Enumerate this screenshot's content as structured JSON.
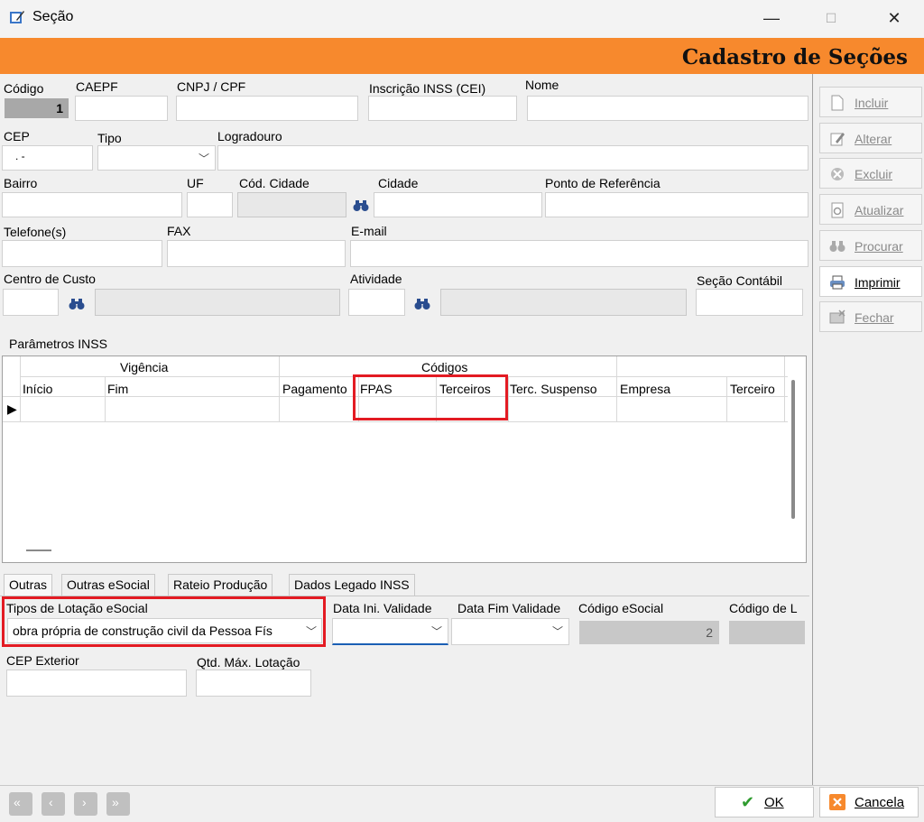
{
  "window": {
    "title": "Seção",
    "minimize": "—",
    "maximize": "☐",
    "close": "✕"
  },
  "header": {
    "title": "Cadastro de Seções"
  },
  "row1": {
    "codigo_label": "Código",
    "codigo_value": "1",
    "caepf_label": "CAEPF",
    "cnpj_label": "CNPJ / CPF",
    "inscricao_label": "Inscrição INSS (CEI)",
    "nome_label": "Nome"
  },
  "row2": {
    "cep_label": "CEP",
    "cep_value": ". -",
    "tipo_label": "Tipo",
    "logradouro_label": "Logradouro"
  },
  "row3": {
    "bairro_label": "Bairro",
    "uf_label": "UF",
    "cod_cidade_label": "Cód. Cidade",
    "cidade_label": "Cidade",
    "ponto_label": "Ponto de Referência"
  },
  "row4": {
    "telefone_label": "Telefone(s)",
    "fax_label": "FAX",
    "email_label": "E-mail"
  },
  "row5": {
    "centro_label": "Centro de Custo",
    "atividade_label": "Atividade",
    "secao_contabil_label": "Seção Contábil"
  },
  "inss": {
    "group_label": "Parâmetros INSS",
    "vigencia": "Vigência",
    "codigos": "Códigos",
    "columns": [
      "Início",
      "Fim",
      "Pagamento",
      "FPAS",
      "Terceiros",
      "Terc. Suspenso",
      "Empresa",
      "Terceiro"
    ]
  },
  "tabs": [
    "Outras",
    "Outras eSocial",
    "Rateio Produção",
    "Dados Legado INSS"
  ],
  "outras": {
    "tipos_label": "Tipos de Lotação eSocial",
    "tipos_value": "obra própria de construção civil da Pessoa Fís",
    "data_ini_label": "Data Ini. Validade",
    "data_fim_label": "Data Fim Validade",
    "codigo_esocial_label": "Código eSocial",
    "codigo_esocial_value": "2",
    "codigo_l_label": "Código de L",
    "cep_exterior_label": "CEP Exterior",
    "qtd_max_label": "Qtd. Máx. Lotação"
  },
  "sidebar": {
    "incluir": "Incluir",
    "alterar": "Alterar",
    "excluir": "Excluir",
    "atualizar": "Atualizar",
    "procurar": "Procurar",
    "imprimir": "Imprimir",
    "fechar": "Fechar"
  },
  "footer": {
    "ok": "OK",
    "cancela": "Cancela"
  },
  "colors": {
    "accent": "#f7892d",
    "highlight": "#e31b23"
  }
}
